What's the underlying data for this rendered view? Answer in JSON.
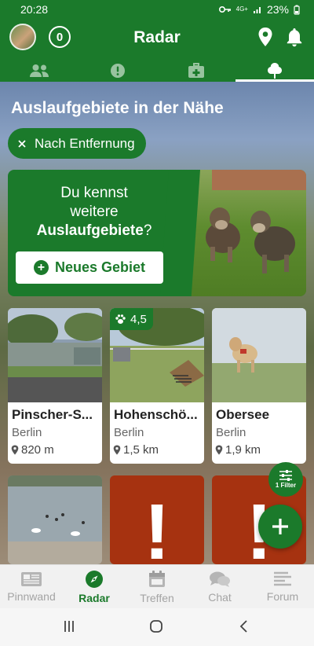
{
  "status": {
    "time": "20:28",
    "net": "4G+",
    "battery": "23%"
  },
  "header": {
    "title": "Radar",
    "notification_count": "0"
  },
  "tabs": [
    {
      "icon": "people-icon"
    },
    {
      "icon": "exclamation-circle-icon"
    },
    {
      "icon": "first-aid-kit-icon"
    },
    {
      "icon": "tree-icon",
      "active": true
    }
  ],
  "section": {
    "heading": "Auslaufgebiete in der Nähe",
    "sort_chip": "Nach Entfernung"
  },
  "promo": {
    "line1": "Du kennst",
    "line2": "weitere",
    "line3_bold": "Auslaufgebiete",
    "line3_end": "?",
    "button": "Neues Gebiet"
  },
  "areas": [
    {
      "name": "Pinscher-S...",
      "city": "Berlin",
      "distance": "820 m"
    },
    {
      "name": "Hohenschö...",
      "city": "Berlin",
      "distance": "1,5 km",
      "rating": "4,5"
    },
    {
      "name": "Obersee",
      "city": "Berlin",
      "distance": "1,9 km"
    }
  ],
  "filter": {
    "label": "1 Filter"
  },
  "nav": [
    {
      "label": "Pinnwand",
      "icon": "newspaper-icon"
    },
    {
      "label": "Radar",
      "icon": "compass-icon",
      "active": true
    },
    {
      "label": "Treffen",
      "icon": "calendar-icon"
    },
    {
      "label": "Chat",
      "icon": "chat-bubbles-icon"
    },
    {
      "label": "Forum",
      "icon": "forum-lines-icon"
    }
  ],
  "colors": {
    "brand": "#1b7a2b",
    "warning": "#a63210"
  }
}
